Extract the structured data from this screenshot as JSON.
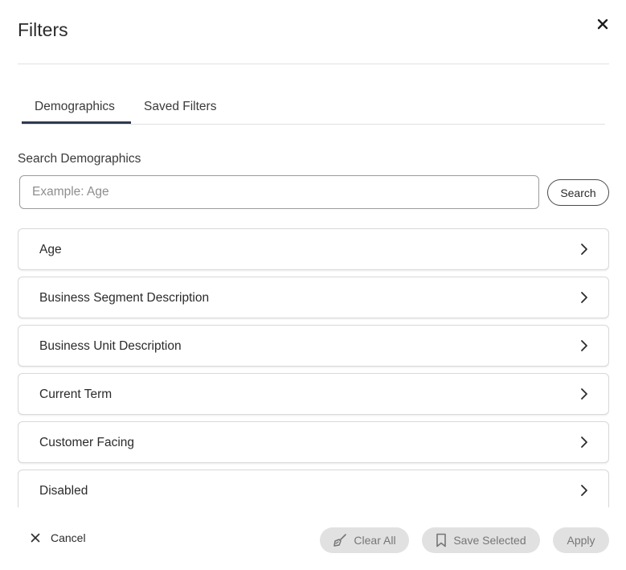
{
  "dialog": {
    "title": "Filters",
    "close_icon": "close-icon"
  },
  "tabs": [
    {
      "label": "Demographics",
      "active": true
    },
    {
      "label": "Saved Filters",
      "active": false
    }
  ],
  "search": {
    "label": "Search Demographics",
    "placeholder": "Example: Age",
    "value": "",
    "button_label": "Search"
  },
  "items": [
    {
      "label": "Age"
    },
    {
      "label": "Business Segment Description"
    },
    {
      "label": "Business Unit Description"
    },
    {
      "label": "Current Term"
    },
    {
      "label": "Customer Facing"
    },
    {
      "label": "Disabled"
    }
  ],
  "footer": {
    "cancel_label": "Cancel",
    "clear_label": "Clear All",
    "save_label": "Save Selected",
    "apply_label": "Apply"
  },
  "colors": {
    "tab_active_underline": "#2e3a4f",
    "disabled_button_bg": "#e1e1e1",
    "disabled_button_text": "#767676"
  }
}
